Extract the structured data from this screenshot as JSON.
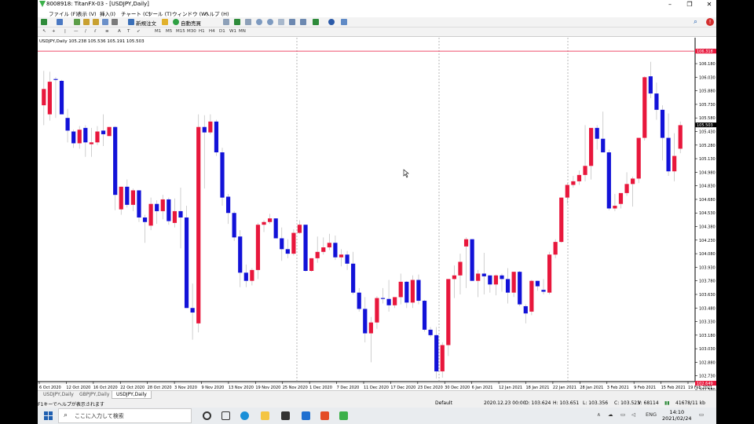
{
  "window": {
    "title": "8008918: TitanFX-03 - [USDJPY,Daily]"
  },
  "menu": {
    "items": [
      "ファイル (F)",
      "表示 (V)",
      "挿入(I)",
      "チャート (C)",
      "ツール (T)",
      "ウィンドウ (W)",
      "ヘルプ (H)"
    ]
  },
  "toolbar": {
    "new_order": "新規注文",
    "auto_trade": "自動売買",
    "timeframes": [
      "M1",
      "M5",
      "M15",
      "M30",
      "H1",
      "H4",
      "D1",
      "W1",
      "MN"
    ]
  },
  "chart": {
    "info": "USDJPY,Daily  105.238 105.536 105.191 105.503",
    "current_price_label": "105.503",
    "top_line_label": "106.318",
    "bottom_line_label": "102.649",
    "price_axis": [
      "106.330",
      "106.180",
      "106.030",
      "105.880",
      "105.730",
      "105.580",
      "105.430",
      "105.280",
      "105.130",
      "104.980",
      "104.830",
      "104.680",
      "104.530",
      "104.380",
      "104.230",
      "104.080",
      "103.930",
      "103.780",
      "103.630",
      "103.480",
      "103.330",
      "103.180",
      "103.030",
      "102.880",
      "102.730",
      "102.580"
    ],
    "date_axis": [
      "6 Oct 2020",
      "12 Oct 2020",
      "16 Oct 2020",
      "22 Oct 2020",
      "28 Oct 2020",
      "3 Nov 2020",
      "9 Nov 2020",
      "13 Nov 2020",
      "19 Nov 2020",
      "25 Nov 2020",
      "1 Dec 2020",
      "7 Dec 2020",
      "11 Dec 2020",
      "17 Dec 2020",
      "23 Dec 2020",
      "30 Dec 2020",
      "6 Jan 2021",
      "12 Jan 2021",
      "18 Jan 2021",
      "22 Jan 2021",
      "28 Jan 2021",
      "3 Feb 2021",
      "9 Feb 2021",
      "15 Feb 2021",
      "19 Feb 2021"
    ],
    "up_color": "#e8173c",
    "down_color": "#1212d8"
  },
  "chart_data": {
    "type": "candlestick",
    "title": "USDJPY,Daily",
    "ylim": [
      102.58,
      106.38
    ],
    "candles": [
      {
        "o": 105.72,
        "h": 106.1,
        "l": 105.5,
        "c": 105.9
      },
      {
        "o": 105.62,
        "h": 106.09,
        "l": 105.55,
        "c": 105.98
      },
      {
        "o": 106.01,
        "h": 106.03,
        "l": 105.58,
        "c": 106.0
      },
      {
        "o": 105.99,
        "h": 106.0,
        "l": 105.62,
        "c": 105.62
      },
      {
        "o": 105.58,
        "h": 105.68,
        "l": 105.31,
        "c": 105.44
      },
      {
        "o": 105.43,
        "h": 105.45,
        "l": 105.25,
        "c": 105.3
      },
      {
        "o": 105.3,
        "h": 105.49,
        "l": 105.24,
        "c": 105.45
      },
      {
        "o": 105.47,
        "h": 105.5,
        "l": 105.15,
        "c": 105.31
      },
      {
        "o": 105.29,
        "h": 105.47,
        "l": 105.15,
        "c": 105.31
      },
      {
        "o": 105.31,
        "h": 105.49,
        "l": 105.28,
        "c": 105.43
      },
      {
        "o": 105.44,
        "h": 105.62,
        "l": 105.27,
        "c": 105.4
      },
      {
        "o": 105.38,
        "h": 105.48,
        "l": 105.38,
        "c": 105.48
      },
      {
        "o": 105.48,
        "h": 105.49,
        "l": 104.56,
        "c": 104.73
      },
      {
        "o": 104.57,
        "h": 104.82,
        "l": 104.51,
        "c": 104.82
      },
      {
        "o": 104.82,
        "h": 104.9,
        "l": 104.59,
        "c": 104.62
      },
      {
        "o": 104.62,
        "h": 104.8,
        "l": 104.55,
        "c": 104.78
      },
      {
        "o": 104.78,
        "h": 104.78,
        "l": 104.43,
        "c": 104.48
      },
      {
        "o": 104.48,
        "h": 104.51,
        "l": 104.2,
        "c": 104.43
      },
      {
        "o": 104.39,
        "h": 104.7,
        "l": 104.34,
        "c": 104.63
      },
      {
        "o": 104.63,
        "h": 104.67,
        "l": 104.41,
        "c": 104.55
      },
      {
        "o": 104.55,
        "h": 104.73,
        "l": 104.46,
        "c": 104.68
      },
      {
        "o": 104.68,
        "h": 104.7,
        "l": 104.4,
        "c": 104.44
      },
      {
        "o": 104.42,
        "h": 104.69,
        "l": 104.37,
        "c": 104.55
      },
      {
        "o": 104.55,
        "h": 104.81,
        "l": 104.14,
        "c": 104.48
      },
      {
        "o": 104.48,
        "h": 104.61,
        "l": 103.48,
        "c": 103.48
      },
      {
        "o": 103.48,
        "h": 103.75,
        "l": 103.13,
        "c": 103.43
      },
      {
        "o": 103.31,
        "h": 105.62,
        "l": 103.21,
        "c": 105.48
      },
      {
        "o": 105.48,
        "h": 105.61,
        "l": 104.8,
        "c": 105.42
      },
      {
        "o": 105.42,
        "h": 105.62,
        "l": 105.4,
        "c": 105.54
      },
      {
        "o": 105.54,
        "h": 105.56,
        "l": 105.16,
        "c": 105.2
      },
      {
        "o": 105.2,
        "h": 105.25,
        "l": 104.61,
        "c": 104.7
      },
      {
        "o": 104.71,
        "h": 104.74,
        "l": 104.41,
        "c": 104.53
      },
      {
        "o": 104.53,
        "h": 104.55,
        "l": 104.22,
        "c": 104.26
      },
      {
        "o": 104.27,
        "h": 104.34,
        "l": 103.71,
        "c": 103.87
      },
      {
        "o": 103.87,
        "h": 103.96,
        "l": 103.71,
        "c": 103.78
      },
      {
        "o": 103.78,
        "h": 103.92,
        "l": 103.73,
        "c": 103.9
      },
      {
        "o": 103.9,
        "h": 104.42,
        "l": 103.8,
        "c": 104.4
      },
      {
        "o": 104.4,
        "h": 104.45,
        "l": 104.32,
        "c": 104.43
      },
      {
        "o": 104.43,
        "h": 104.52,
        "l": 104.41,
        "c": 104.47
      },
      {
        "o": 104.47,
        "h": 104.47,
        "l": 104.25,
        "c": 104.25
      },
      {
        "o": 104.25,
        "h": 104.37,
        "l": 104.0,
        "c": 104.13
      },
      {
        "o": 104.13,
        "h": 104.24,
        "l": 104.03,
        "c": 104.08
      },
      {
        "o": 104.08,
        "h": 104.35,
        "l": 104.06,
        "c": 104.31
      },
      {
        "o": 104.31,
        "h": 104.45,
        "l": 104.3,
        "c": 104.4
      },
      {
        "o": 104.4,
        "h": 104.4,
        "l": 103.88,
        "c": 103.89
      },
      {
        "o": 103.89,
        "h": 104.03,
        "l": 103.88,
        "c": 104.03
      },
      {
        "o": 104.03,
        "h": 104.27,
        "l": 103.98,
        "c": 104.1
      },
      {
        "o": 104.1,
        "h": 104.26,
        "l": 104.07,
        "c": 104.15
      },
      {
        "o": 104.15,
        "h": 104.3,
        "l": 104.12,
        "c": 104.2
      },
      {
        "o": 104.2,
        "h": 104.28,
        "l": 104.01,
        "c": 104.04
      },
      {
        "o": 104.04,
        "h": 104.13,
        "l": 103.94,
        "c": 104.07
      },
      {
        "o": 104.07,
        "h": 104.11,
        "l": 103.9,
        "c": 103.97
      },
      {
        "o": 103.97,
        "h": 104.1,
        "l": 103.63,
        "c": 103.65
      },
      {
        "o": 103.65,
        "h": 103.7,
        "l": 103.44,
        "c": 103.47
      },
      {
        "o": 103.47,
        "h": 103.6,
        "l": 103.1,
        "c": 103.2
      },
      {
        "o": 103.2,
        "h": 103.38,
        "l": 102.88,
        "c": 103.32
      },
      {
        "o": 103.32,
        "h": 103.61,
        "l": 103.25,
        "c": 103.59
      },
      {
        "o": 103.59,
        "h": 103.7,
        "l": 103.53,
        "c": 103.58
      },
      {
        "o": 103.58,
        "h": 103.79,
        "l": 103.44,
        "c": 103.51
      },
      {
        "o": 103.51,
        "h": 103.6,
        "l": 103.48,
        "c": 103.6
      },
      {
        "o": 103.6,
        "h": 103.86,
        "l": 103.52,
        "c": 103.77
      },
      {
        "o": 103.77,
        "h": 103.78,
        "l": 103.48,
        "c": 103.54
      },
      {
        "o": 103.54,
        "h": 103.84,
        "l": 103.48,
        "c": 103.79
      },
      {
        "o": 103.79,
        "h": 103.85,
        "l": 103.52,
        "c": 103.56
      },
      {
        "o": 103.56,
        "h": 103.57,
        "l": 103.22,
        "c": 103.24
      },
      {
        "o": 103.24,
        "h": 103.27,
        "l": 103.16,
        "c": 103.18
      },
      {
        "o": 103.18,
        "h": 103.27,
        "l": 102.7,
        "c": 102.78
      },
      {
        "o": 102.78,
        "h": 103.1,
        "l": 102.71,
        "c": 103.07
      },
      {
        "o": 103.07,
        "h": 103.8,
        "l": 102.95,
        "c": 103.8
      },
      {
        "o": 103.8,
        "h": 103.95,
        "l": 103.59,
        "c": 103.84
      },
      {
        "o": 103.84,
        "h": 104.08,
        "l": 103.63,
        "c": 103.99
      },
      {
        "o": 104.16,
        "h": 104.26,
        "l": 103.7,
        "c": 104.24
      },
      {
        "o": 104.24,
        "h": 104.24,
        "l": 103.78,
        "c": 103.78
      },
      {
        "o": 103.78,
        "h": 103.9,
        "l": 103.6,
        "c": 103.86
      },
      {
        "o": 103.86,
        "h": 104.09,
        "l": 103.63,
        "c": 103.83
      },
      {
        "o": 103.84,
        "h": 103.84,
        "l": 103.65,
        "c": 103.74
      },
      {
        "o": 103.74,
        "h": 103.85,
        "l": 103.62,
        "c": 103.84
      },
      {
        "o": 103.84,
        "h": 103.86,
        "l": 103.66,
        "c": 103.8
      },
      {
        "o": 103.8,
        "h": 103.92,
        "l": 103.53,
        "c": 103.65
      },
      {
        "o": 103.65,
        "h": 103.86,
        "l": 103.6,
        "c": 103.88
      },
      {
        "o": 103.88,
        "h": 103.89,
        "l": 103.5,
        "c": 103.52
      },
      {
        "o": 103.5,
        "h": 103.52,
        "l": 103.31,
        "c": 103.42
      },
      {
        "o": 103.44,
        "h": 103.79,
        "l": 103.4,
        "c": 103.78
      },
      {
        "o": 103.78,
        "h": 103.78,
        "l": 103.67,
        "c": 103.72
      },
      {
        "o": 103.68,
        "h": 103.8,
        "l": 103.63,
        "c": 103.66
      },
      {
        "o": 103.65,
        "h": 104.1,
        "l": 103.63,
        "c": 104.07
      },
      {
        "o": 104.07,
        "h": 104.24,
        "l": 104.03,
        "c": 104.21
      },
      {
        "o": 104.21,
        "h": 104.7,
        "l": 104.2,
        "c": 104.7
      },
      {
        "o": 104.7,
        "h": 104.86,
        "l": 104.63,
        "c": 104.84
      },
      {
        "o": 104.84,
        "h": 104.94,
        "l": 104.81,
        "c": 104.88
      },
      {
        "o": 104.88,
        "h": 105.0,
        "l": 104.84,
        "c": 104.95
      },
      {
        "o": 104.95,
        "h": 105.5,
        "l": 104.88,
        "c": 105.05
      },
      {
        "o": 105.05,
        "h": 105.46,
        "l": 104.9,
        "c": 105.47
      },
      {
        "o": 105.47,
        "h": 105.5,
        "l": 105.23,
        "c": 105.35
      },
      {
        "o": 105.35,
        "h": 105.65,
        "l": 105.3,
        "c": 105.2
      },
      {
        "o": 105.2,
        "h": 105.23,
        "l": 104.56,
        "c": 104.58
      },
      {
        "o": 104.58,
        "h": 104.74,
        "l": 104.55,
        "c": 104.61
      },
      {
        "o": 104.63,
        "h": 104.73,
        "l": 104.58,
        "c": 104.75
      },
      {
        "o": 104.75,
        "h": 104.98,
        "l": 104.72,
        "c": 104.85
      },
      {
        "o": 104.85,
        "h": 104.93,
        "l": 104.6,
        "c": 104.91
      },
      {
        "o": 104.91,
        "h": 105.29,
        "l": 104.86,
        "c": 105.36
      },
      {
        "o": 105.36,
        "h": 106.04,
        "l": 105.33,
        "c": 106.03
      },
      {
        "o": 106.04,
        "h": 106.2,
        "l": 105.8,
        "c": 105.85
      },
      {
        "o": 105.85,
        "h": 105.97,
        "l": 105.56,
        "c": 105.67
      },
      {
        "o": 105.67,
        "h": 105.72,
        "l": 105.11,
        "c": 105.36
      },
      {
        "o": 105.36,
        "h": 105.63,
        "l": 104.94,
        "c": 104.99
      },
      {
        "o": 104.99,
        "h": 105.41,
        "l": 104.88,
        "c": 105.16
      },
      {
        "o": 105.24,
        "h": 105.54,
        "l": 105.19,
        "c": 105.5
      }
    ]
  },
  "tabs": [
    "USDJPY,Daily",
    "GBPJPY,Daily",
    "USDJPY,Daily"
  ],
  "status": {
    "help": "F1キーでヘルプが表示されます",
    "profile": "Default",
    "datetime": "2020.12.23 00:00",
    "open": "O: 103.624",
    "high": "H: 103.651",
    "low": "L: 103.356",
    "close": "C: 103.523",
    "volume": "V: 68114",
    "traffic": "41678/11 kb"
  },
  "taskbar": {
    "search_placeholder": "ここに入力して検索",
    "lang": "ENG",
    "time": "14:10",
    "date": "2021/02/24"
  }
}
